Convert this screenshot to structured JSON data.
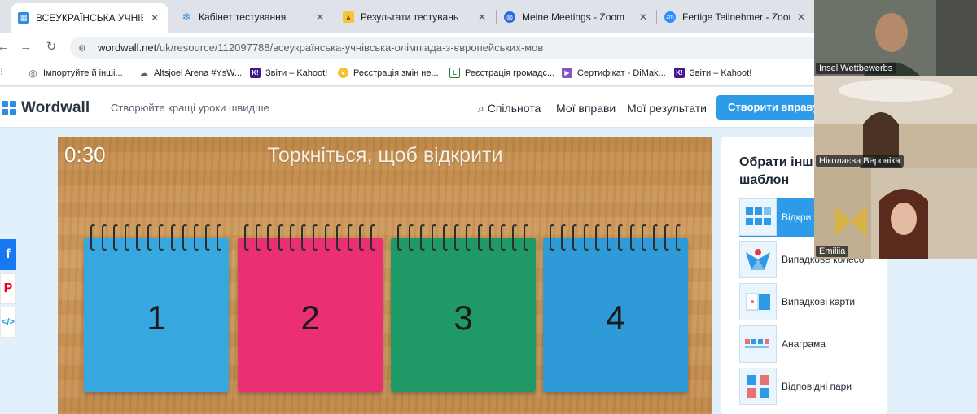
{
  "browser": {
    "tabs": [
      {
        "label": "ВСЕУКРАЇНСЬКА УЧНІВСЬКА",
        "favicon": "wordwall-icon",
        "active": true
      },
      {
        "label": "Кабінет тестування",
        "favicon": "snowflake-icon",
        "active": false
      },
      {
        "label": "Результати тестувань",
        "favicon": "bell-icon",
        "active": false
      },
      {
        "label": "Meine Meetings - Zoom",
        "favicon": "globe-icon",
        "active": false
      },
      {
        "label": "Fertige Teilnehmer - Zoom",
        "favicon": "zoom-icon",
        "active": false
      }
    ],
    "url_host": "wordwall.net",
    "url_path": "/uk/resource/112097788/всеукраїнська-учнівська-олімпіада-з-європейських-мов",
    "bookmarks": [
      {
        "label": "Імпортуйте й інші...",
        "icon": "globe-icon",
        "color": "#5f6368"
      },
      {
        "label": "Altsjoel Arena #YsW...",
        "icon": "cloud-icon",
        "color": "#5f6368"
      },
      {
        "label": "Звіти – Kahoot!",
        "icon": "kahoot-icon",
        "color": "#46178f"
      },
      {
        "label": "Реєстрація змін не...",
        "icon": "seal-icon",
        "color": "#e0b030"
      },
      {
        "label": "Реєстрація громадс...",
        "icon": "document-icon",
        "color": "#2e7d32"
      },
      {
        "label": "Сертифікат - DiMak...",
        "icon": "shield-icon",
        "color": "#7e57c2"
      },
      {
        "label": "Звіти – Kahoot!",
        "icon": "kahoot-icon",
        "color": "#46178f"
      }
    ]
  },
  "wordwall": {
    "logo": "Wordwall",
    "tagline": "Створюйте кращі уроки швидше",
    "nav": [
      "Спільнота",
      "Мої вправи",
      "Мої результати"
    ],
    "cta": "Створити вправу"
  },
  "game": {
    "timer": "0:30",
    "prompt": "Торкніться, щоб відкрити",
    "cards": [
      {
        "label": "1",
        "color": "#36a7df"
      },
      {
        "label": "2",
        "color": "#ea2f72"
      },
      {
        "label": "3",
        "color": "#1f9a66"
      },
      {
        "label": "4",
        "color": "#2f9ad8"
      }
    ]
  },
  "sidebar": {
    "title": "Обрати інш шаблон",
    "templates": [
      {
        "label": "Відкри коробк",
        "selected": true
      },
      {
        "label": "Випадкове колесо",
        "selected": false
      },
      {
        "label": "Випадкові карти",
        "selected": false
      },
      {
        "label": "Анаграма",
        "selected": false
      },
      {
        "label": "Відповідні пари",
        "selected": false
      }
    ]
  },
  "social": [
    {
      "icon": "facebook-icon",
      "glyph": "f",
      "color": "#1877f2"
    },
    {
      "icon": "pinterest-icon",
      "glyph": "P",
      "color": "#e60023"
    },
    {
      "icon": "embed-icon",
      "glyph": "</>",
      "color": "#2d9be8"
    }
  ],
  "participants": [
    {
      "name": "Insel Wettbewerbs"
    },
    {
      "name": "Ніколаєва Вероніка"
    },
    {
      "name": "Emiliia"
    }
  ]
}
